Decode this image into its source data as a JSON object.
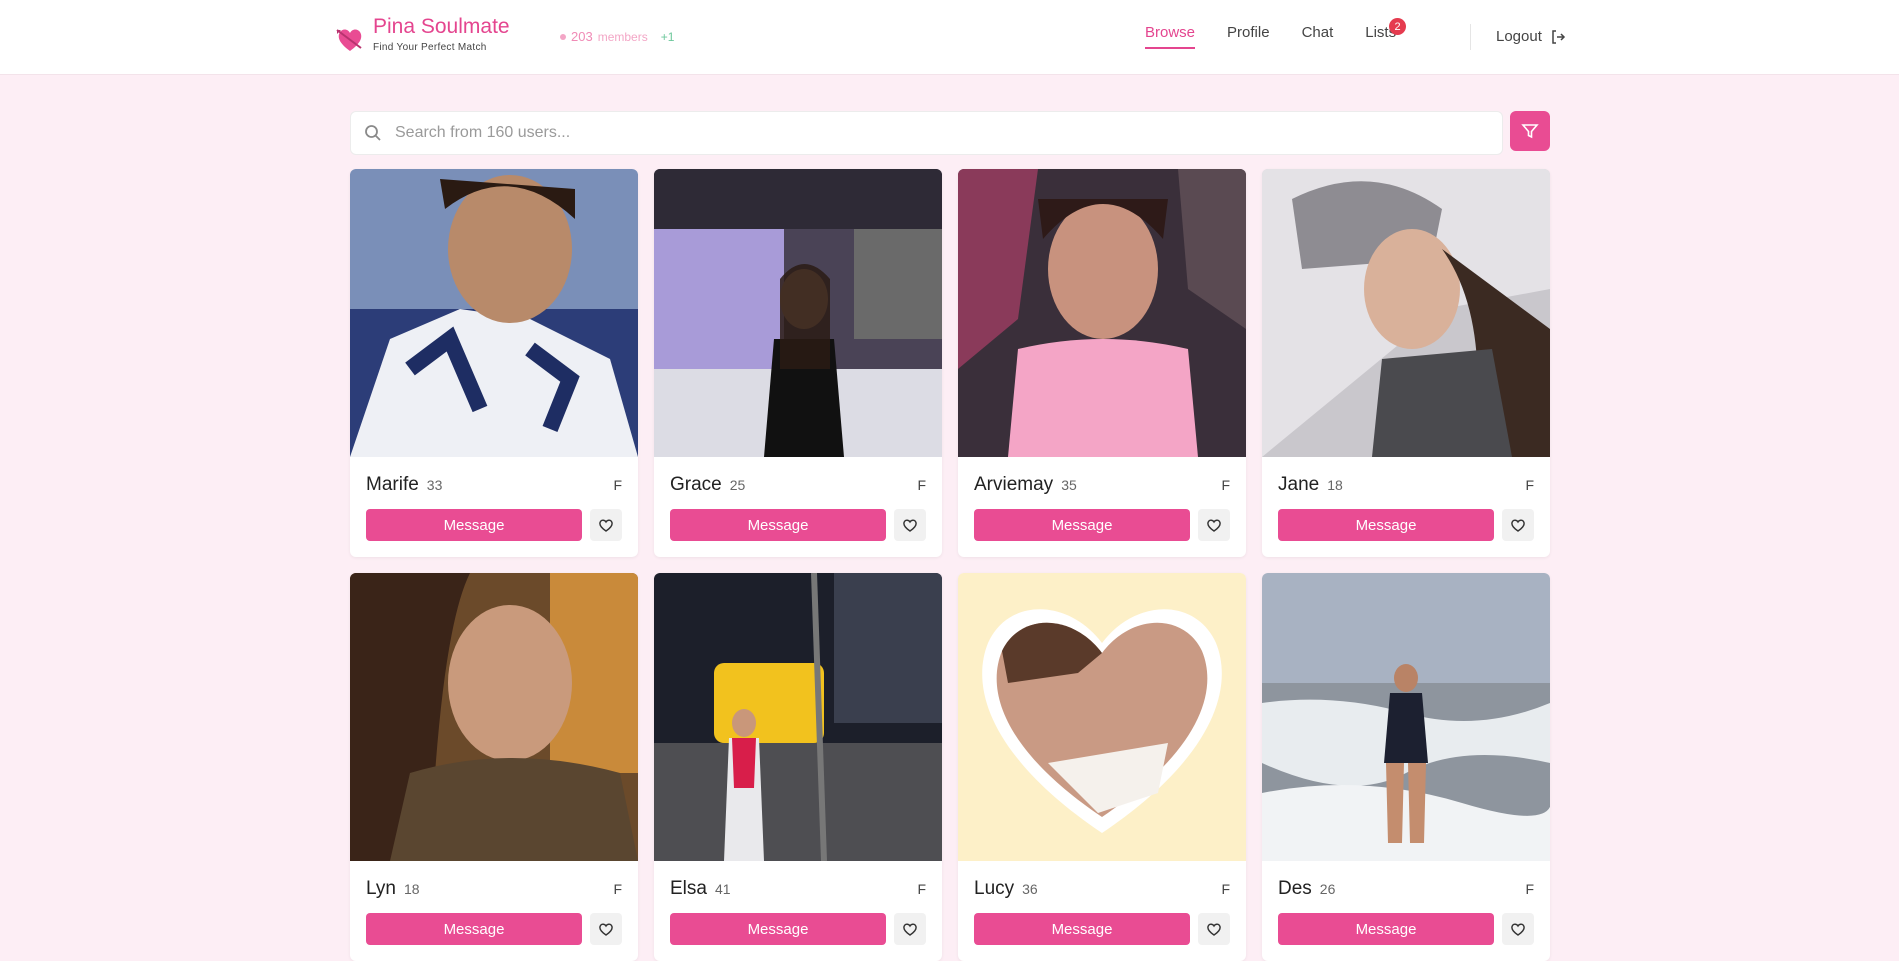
{
  "brand": {
    "title": "Pina Soulmate",
    "tagline": "Find Your Perfect Match"
  },
  "members": {
    "count": "203",
    "label": "members",
    "delta": "+1"
  },
  "nav": {
    "items": [
      {
        "label": "Browse",
        "active": true
      },
      {
        "label": "Profile"
      },
      {
        "label": "Chat"
      },
      {
        "label": "Lists",
        "badge": "2"
      }
    ],
    "logout": "Logout"
  },
  "search": {
    "placeholder": "Search from 160 users..."
  },
  "profiles": [
    {
      "name": "Marife",
      "age": "33",
      "gender": "F",
      "message_label": "Message"
    },
    {
      "name": "Grace",
      "age": "25",
      "gender": "F",
      "message_label": "Message"
    },
    {
      "name": "Arviemay",
      "age": "35",
      "gender": "F",
      "message_label": "Message"
    },
    {
      "name": "Jane",
      "age": "18",
      "gender": "F",
      "message_label": "Message"
    },
    {
      "name": "Lyn",
      "age": "18",
      "gender": "F",
      "message_label": "Message"
    },
    {
      "name": "Elsa",
      "age": "41",
      "gender": "F",
      "message_label": "Message"
    },
    {
      "name": "Lucy",
      "age": "36",
      "gender": "F",
      "message_label": "Message"
    },
    {
      "name": "Des",
      "age": "26",
      "gender": "F",
      "message_label": "Message"
    }
  ],
  "colors": {
    "accent": "#e94c93",
    "background": "#fdeef5",
    "badge": "#e53b4f"
  }
}
